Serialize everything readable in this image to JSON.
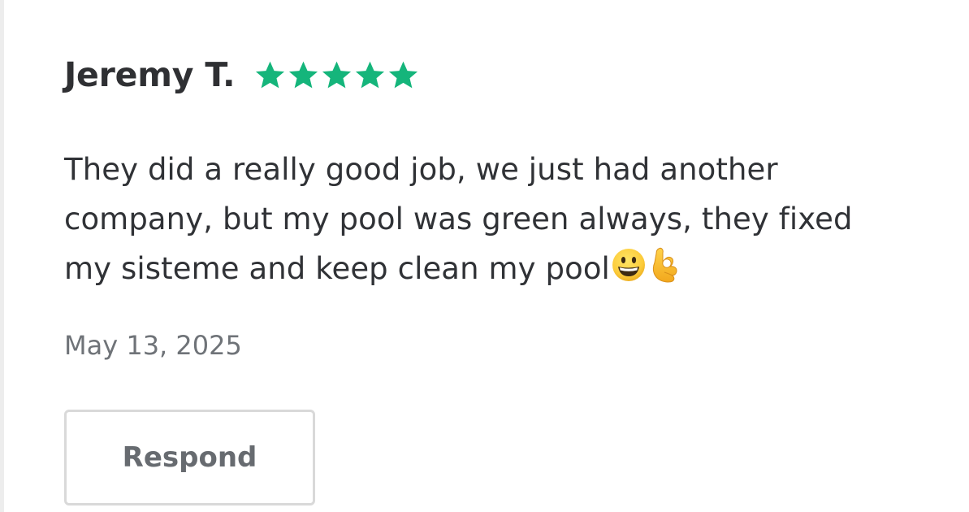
{
  "review": {
    "reviewer_name": "Jeremy T.",
    "rating": 5,
    "rating_max": 5,
    "star_color": "#15b57b",
    "text_line_1": "They did a really good job, we just had another",
    "text_line_2": "company, but my pool was green always, they fixed",
    "text_line_3": "my sisteme and keep clean my pool",
    "emoji_1": "grinning-face-emoji",
    "emoji_2": "ok-hand-emoji",
    "date": "May 13, 2025"
  },
  "actions": {
    "respond_label": "Respond"
  }
}
